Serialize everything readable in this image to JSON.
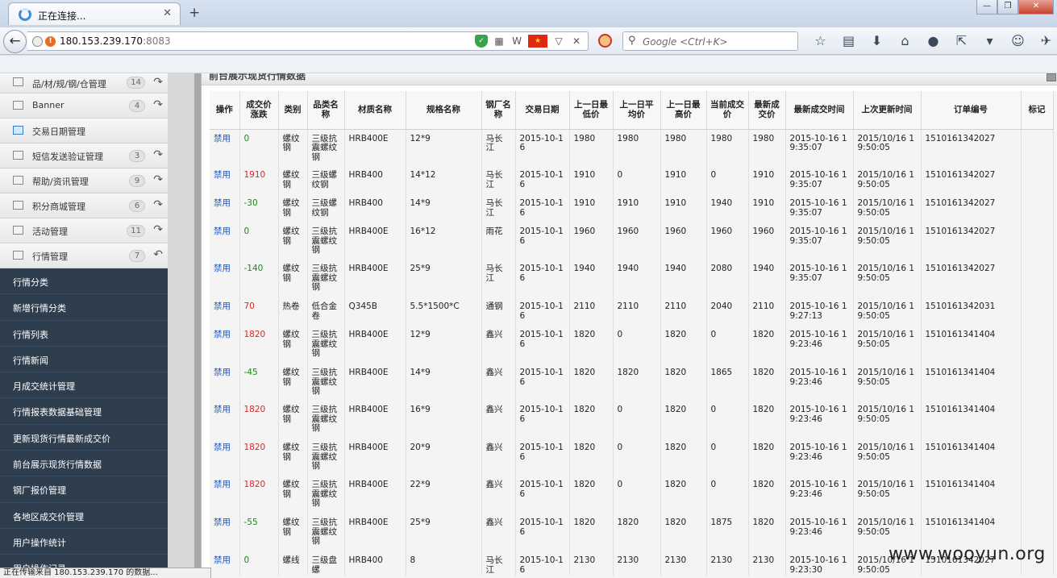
{
  "browser": {
    "tab_title": "正在连接...",
    "new_tab_symbol": "+",
    "url_host": "180.153.239.170",
    "url_port": ":8083",
    "search_placeholder": "Google <Ctrl+K>"
  },
  "status_text": "正在传输来自 180.153.239.170 的数据...",
  "watermark": "www.wooyun.org",
  "sidebar": {
    "menu_items": [
      {
        "label": "品/材/规/钢/仓管理",
        "badge": "14",
        "icon": "doc-icon",
        "arrow": "↷"
      },
      {
        "label": "Banner",
        "badge": "4",
        "icon": "doc-icon",
        "arrow": "↷"
      },
      {
        "label": "交易日期管理",
        "badge": "",
        "icon": "calendar-icon",
        "arrow": ""
      },
      {
        "label": "短信发送验证管理",
        "badge": "3",
        "icon": "doc-icon",
        "arrow": "↷"
      },
      {
        "label": "帮助/资讯管理",
        "badge": "9",
        "icon": "grid-icon",
        "arrow": "↷"
      },
      {
        "label": "积分商城管理",
        "badge": "6",
        "icon": "grid-icon",
        "arrow": "↷"
      },
      {
        "label": "活动管理",
        "badge": "11",
        "icon": "grid-icon",
        "arrow": "↷"
      },
      {
        "label": "行情管理",
        "badge": "7",
        "icon": "grid-icon",
        "arrow": "↶"
      }
    ],
    "sub_items": [
      "行情分类",
      "新增行情分类",
      "行情列表",
      "行情新闻",
      "月成交统计管理",
      "行情报表数据基础管理",
      "更新现货行情最新成交价",
      "前台展示现货行情数据",
      "钢厂报价管理",
      "各地区成交价管理",
      "用户操作统计",
      "用户操作记录"
    ]
  },
  "panel": {
    "title": "前台展示现货行情数据",
    "columns": [
      "操作",
      "成交价涨跌",
      "类别",
      "品类名称",
      "材质名称",
      "规格名称",
      "钢厂名称",
      "交易日期",
      "上一日最低价",
      "上一日平均价",
      "上一日最高价",
      "当前成交价",
      "最新成交价",
      "最新成交时间",
      "上次更新时间",
      "订单编号",
      "标记"
    ],
    "rows": [
      {
        "op": "禁用",
        "change": "0",
        "dir": "pos",
        "cat": "螺纹钢",
        "name": "三级抗震螺纹钢",
        "mat": "HRB400E",
        "spec": "12*9",
        "mill": "马长江",
        "date": "2015-10-16",
        "low": "1980",
        "avg": "1980",
        "high": "1980",
        "cur": "1980",
        "latest": "1980",
        "ltime": "2015-10-16 19:35:07",
        "utime": "2015/10/16 19:50:05",
        "order": "1510161342027",
        "mark": ""
      },
      {
        "op": "禁用",
        "change": "1910",
        "dir": "neg",
        "cat": "螺纹钢",
        "name": "三级螺纹钢",
        "mat": "HRB400",
        "spec": "14*12",
        "mill": "马长江",
        "date": "2015-10-16",
        "low": "1910",
        "avg": "0",
        "high": "1910",
        "cur": "0",
        "latest": "1910",
        "ltime": "2015-10-16 19:35:07",
        "utime": "2015/10/16 19:50:05",
        "order": "1510161342027",
        "mark": ""
      },
      {
        "op": "禁用",
        "change": "-30",
        "dir": "pos",
        "cat": "螺纹钢",
        "name": "三级螺纹钢",
        "mat": "HRB400",
        "spec": "14*9",
        "mill": "马长江",
        "date": "2015-10-16",
        "low": "1910",
        "avg": "1910",
        "high": "1910",
        "cur": "1940",
        "latest": "1910",
        "ltime": "2015-10-16 19:35:07",
        "utime": "2015/10/16 19:50:05",
        "order": "1510161342027",
        "mark": ""
      },
      {
        "op": "禁用",
        "change": "0",
        "dir": "pos",
        "cat": "螺纹钢",
        "name": "三级抗震螺纹钢",
        "mat": "HRB400E",
        "spec": "16*12",
        "mill": "雨花",
        "date": "2015-10-16",
        "low": "1960",
        "avg": "1960",
        "high": "1960",
        "cur": "1960",
        "latest": "1960",
        "ltime": "2015-10-16 19:35:07",
        "utime": "2015/10/16 19:50:05",
        "order": "1510161342027",
        "mark": ""
      },
      {
        "op": "禁用",
        "change": "-140",
        "dir": "pos",
        "cat": "螺纹钢",
        "name": "三级抗震螺纹钢",
        "mat": "HRB400E",
        "spec": "25*9",
        "mill": "马长江",
        "date": "2015-10-16",
        "low": "1940",
        "avg": "1940",
        "high": "1940",
        "cur": "2080",
        "latest": "1940",
        "ltime": "2015-10-16 19:35:07",
        "utime": "2015/10/16 19:50:05",
        "order": "1510161342027",
        "mark": ""
      },
      {
        "op": "禁用",
        "change": "70",
        "dir": "neg",
        "cat": "热卷",
        "name": "低合金卷",
        "mat": "Q345B",
        "spec": "5.5*1500*C",
        "mill": "通钢",
        "date": "2015-10-16",
        "low": "2110",
        "avg": "2110",
        "high": "2110",
        "cur": "2040",
        "latest": "2110",
        "ltime": "2015-10-16 19:27:13",
        "utime": "2015/10/16 19:50:05",
        "order": "1510161342031",
        "mark": ""
      },
      {
        "op": "禁用",
        "change": "1820",
        "dir": "neg",
        "cat": "螺纹钢",
        "name": "三级抗震螺纹钢",
        "mat": "HRB400E",
        "spec": "12*9",
        "mill": "鑫兴",
        "date": "2015-10-16",
        "low": "1820",
        "avg": "0",
        "high": "1820",
        "cur": "0",
        "latest": "1820",
        "ltime": "2015-10-16 19:23:46",
        "utime": "2015/10/16 19:50:05",
        "order": "1510161341404",
        "mark": ""
      },
      {
        "op": "禁用",
        "change": "-45",
        "dir": "pos",
        "cat": "螺纹钢",
        "name": "三级抗震螺纹钢",
        "mat": "HRB400E",
        "spec": "14*9",
        "mill": "鑫兴",
        "date": "2015-10-16",
        "low": "1820",
        "avg": "1820",
        "high": "1820",
        "cur": "1865",
        "latest": "1820",
        "ltime": "2015-10-16 19:23:46",
        "utime": "2015/10/16 19:50:05",
        "order": "1510161341404",
        "mark": ""
      },
      {
        "op": "禁用",
        "change": "1820",
        "dir": "neg",
        "cat": "螺纹钢",
        "name": "三级抗震螺纹钢",
        "mat": "HRB400E",
        "spec": "16*9",
        "mill": "鑫兴",
        "date": "2015-10-16",
        "low": "1820",
        "avg": "0",
        "high": "1820",
        "cur": "0",
        "latest": "1820",
        "ltime": "2015-10-16 19:23:46",
        "utime": "2015/10/16 19:50:05",
        "order": "1510161341404",
        "mark": ""
      },
      {
        "op": "禁用",
        "change": "1820",
        "dir": "neg",
        "cat": "螺纹钢",
        "name": "三级抗震螺纹钢",
        "mat": "HRB400E",
        "spec": "20*9",
        "mill": "鑫兴",
        "date": "2015-10-16",
        "low": "1820",
        "avg": "0",
        "high": "1820",
        "cur": "0",
        "latest": "1820",
        "ltime": "2015-10-16 19:23:46",
        "utime": "2015/10/16 19:50:05",
        "order": "1510161341404",
        "mark": ""
      },
      {
        "op": "禁用",
        "change": "1820",
        "dir": "neg",
        "cat": "螺纹钢",
        "name": "三级抗震螺纹钢",
        "mat": "HRB400E",
        "spec": "22*9",
        "mill": "鑫兴",
        "date": "2015-10-16",
        "low": "1820",
        "avg": "0",
        "high": "1820",
        "cur": "0",
        "latest": "1820",
        "ltime": "2015-10-16 19:23:46",
        "utime": "2015/10/16 19:50:05",
        "order": "1510161341404",
        "mark": ""
      },
      {
        "op": "禁用",
        "change": "-55",
        "dir": "pos",
        "cat": "螺纹钢",
        "name": "三级抗震螺纹钢",
        "mat": "HRB400E",
        "spec": "25*9",
        "mill": "鑫兴",
        "date": "2015-10-16",
        "low": "1820",
        "avg": "1820",
        "high": "1820",
        "cur": "1875",
        "latest": "1820",
        "ltime": "2015-10-16 19:23:46",
        "utime": "2015/10/16 19:50:05",
        "order": "1510161341404",
        "mark": ""
      },
      {
        "op": "禁用",
        "change": "0",
        "dir": "pos",
        "cat": "螺线",
        "name": "三级盘螺",
        "mat": "HRB400",
        "spec": "8",
        "mill": "马长江",
        "date": "2015-10-16",
        "low": "2130",
        "avg": "2130",
        "high": "2130",
        "cur": "2130",
        "latest": "2130",
        "ltime": "2015-10-16 19:23:30",
        "utime": "2015/10/16 19:50:05",
        "order": "1510161342027",
        "mark": ""
      }
    ]
  },
  "colors": {
    "positive": "#1a8a1a",
    "negative": "#d12a2a",
    "link": "#1f54b5",
    "sidebar_dark": "#2f3e4e"
  }
}
